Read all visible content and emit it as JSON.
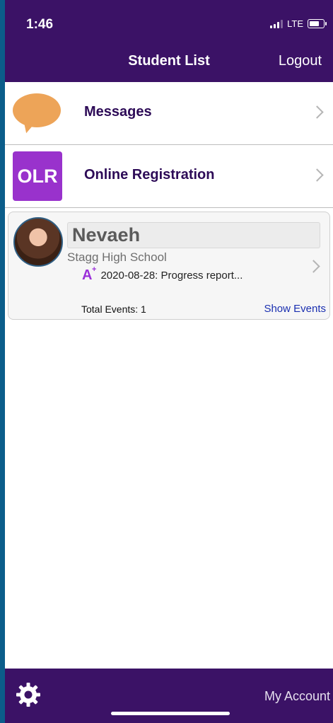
{
  "status_bar": {
    "time": "1:46",
    "network": "LTE"
  },
  "header": {
    "title": "Student List",
    "logout_label": "Logout"
  },
  "menu": [
    {
      "label": "Messages",
      "icon": "chat-bubble-icon"
    },
    {
      "label": "Online Registration",
      "icon_text": "OLR"
    }
  ],
  "student": {
    "name": "Nevaeh",
    "school": "Stagg High School",
    "event_text": "2020-08-28: Progress report...",
    "grade_icon": "A",
    "total_events_label": "Total Events: 1",
    "show_events_label": "Show Events"
  },
  "footer": {
    "account_label": "My Account"
  },
  "colors": {
    "header": "#3b1266",
    "olr": "#9932cc",
    "bubble": "#eda458",
    "link": "#1a2fb0"
  }
}
